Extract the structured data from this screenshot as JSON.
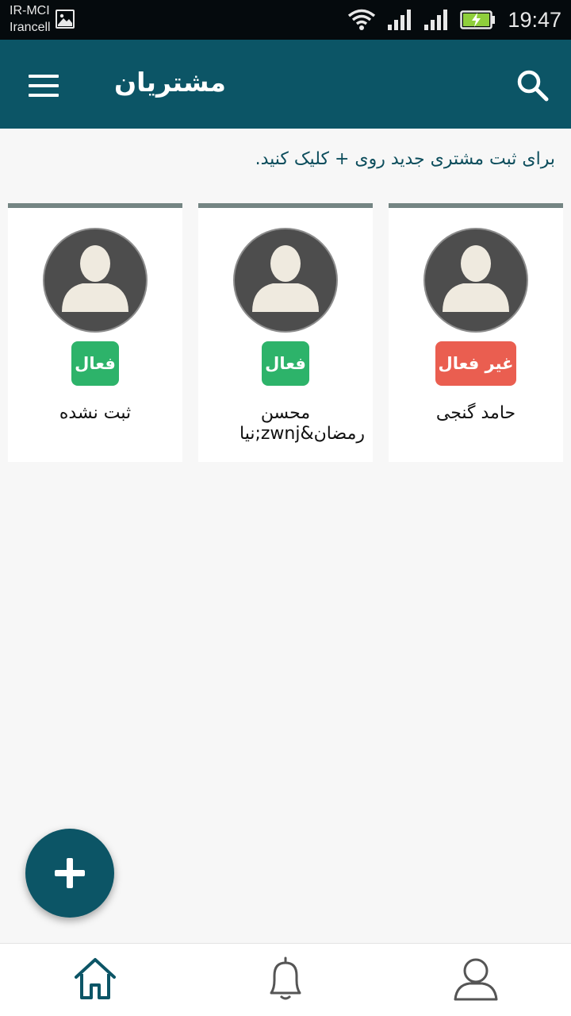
{
  "status_bar": {
    "carrier_line1": "IR-MCI",
    "carrier_line2": "Irancell",
    "time": "19:47",
    "icons": [
      "gallery-icon",
      "wifi-icon",
      "signal-icon",
      "signal-icon",
      "battery-charging-icon"
    ]
  },
  "app_bar": {
    "title": "مشتریان",
    "menu_icon": "hamburger-menu-icon",
    "search_icon": "search-icon"
  },
  "hint": "برای ثبت مشتری جدید روی + کلیک کنید.",
  "customers": [
    {
      "name": "حامد گنجی",
      "status": "غیر فعال",
      "status_color": "#ea5e50"
    },
    {
      "name_line1": "محسن",
      "name_line2": "رمضان&zwnj;نیا",
      "status": "فعال",
      "status_color": "#2db36a"
    },
    {
      "name": "ثبت نشده",
      "status": "فعال",
      "status_color": "#2db36a"
    }
  ],
  "fab": {
    "icon": "plus-icon"
  },
  "bottom_nav": [
    {
      "icon": "home-icon",
      "active": true
    },
    {
      "icon": "bell-icon",
      "active": false
    },
    {
      "icon": "user-profile-icon",
      "active": false
    }
  ],
  "colors": {
    "primary": "#0c5566",
    "active_badge": "#2db36a",
    "inactive_badge": "#ea5e50",
    "card_top_border": "#748583"
  }
}
